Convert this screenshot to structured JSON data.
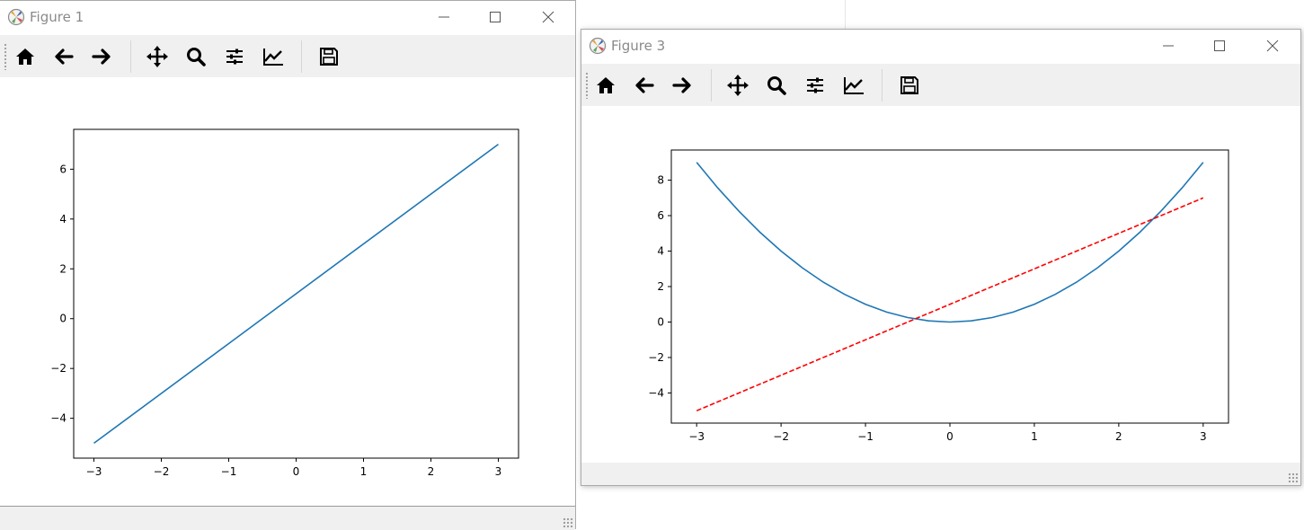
{
  "windows": [
    {
      "title": "Figure 1",
      "status_message": "",
      "toolbar": [
        "home-icon",
        "back-icon",
        "forward-icon",
        "pan-icon",
        "zoom-icon",
        "subplots-icon",
        "customize-icon",
        "save-icon"
      ]
    },
    {
      "title": "Figure 3",
      "status_message": "",
      "toolbar": [
        "home-icon",
        "back-icon",
        "forward-icon",
        "pan-icon",
        "zoom-icon",
        "subplots-icon",
        "customize-icon",
        "save-icon"
      ]
    }
  ],
  "chart_data": [
    {
      "type": "line",
      "title": "",
      "xlabel": "",
      "ylabel": "",
      "xlim": [
        -3.3,
        3.3
      ],
      "ylim": [
        -5.6,
        7.6
      ],
      "xticks": [
        -3,
        -2,
        -1,
        0,
        1,
        2,
        3
      ],
      "yticks": [
        -4,
        -2,
        0,
        2,
        4,
        6
      ],
      "grid": false,
      "series": [
        {
          "x": [
            -3,
            3
          ],
          "y": [
            -5,
            7
          ],
          "color": "#1f77b4",
          "style": "solid"
        }
      ]
    },
    {
      "type": "line",
      "title": "",
      "xlabel": "",
      "ylabel": "",
      "xlim": [
        -3.3,
        3.3
      ],
      "ylim": [
        -5.7,
        9.7
      ],
      "xticks": [
        -3,
        -2,
        -1,
        0,
        1,
        2,
        3
      ],
      "yticks": [
        -4,
        -2,
        0,
        2,
        4,
        6,
        8
      ],
      "grid": false,
      "series": [
        {
          "x": [
            -3,
            -2.75,
            -2.5,
            -2.25,
            -2,
            -1.75,
            -1.5,
            -1.25,
            -1,
            -0.75,
            -0.5,
            -0.25,
            0,
            0.25,
            0.5,
            0.75,
            1,
            1.25,
            1.5,
            1.75,
            2,
            2.25,
            2.5,
            2.75,
            3
          ],
          "y": [
            9,
            7.5625,
            6.25,
            5.0625,
            4,
            3.0625,
            2.25,
            1.5625,
            1,
            0.5625,
            0.25,
            0.0625,
            0,
            0.0625,
            0.25,
            0.5625,
            1,
            1.5625,
            2.25,
            3.0625,
            4,
            5.0625,
            6.25,
            7.5625,
            9
          ],
          "color": "#1f77b4",
          "style": "solid"
        },
        {
          "x": [
            -3,
            3
          ],
          "y": [
            -5,
            7
          ],
          "color": "#ff0000",
          "style": "dashed"
        }
      ]
    }
  ]
}
